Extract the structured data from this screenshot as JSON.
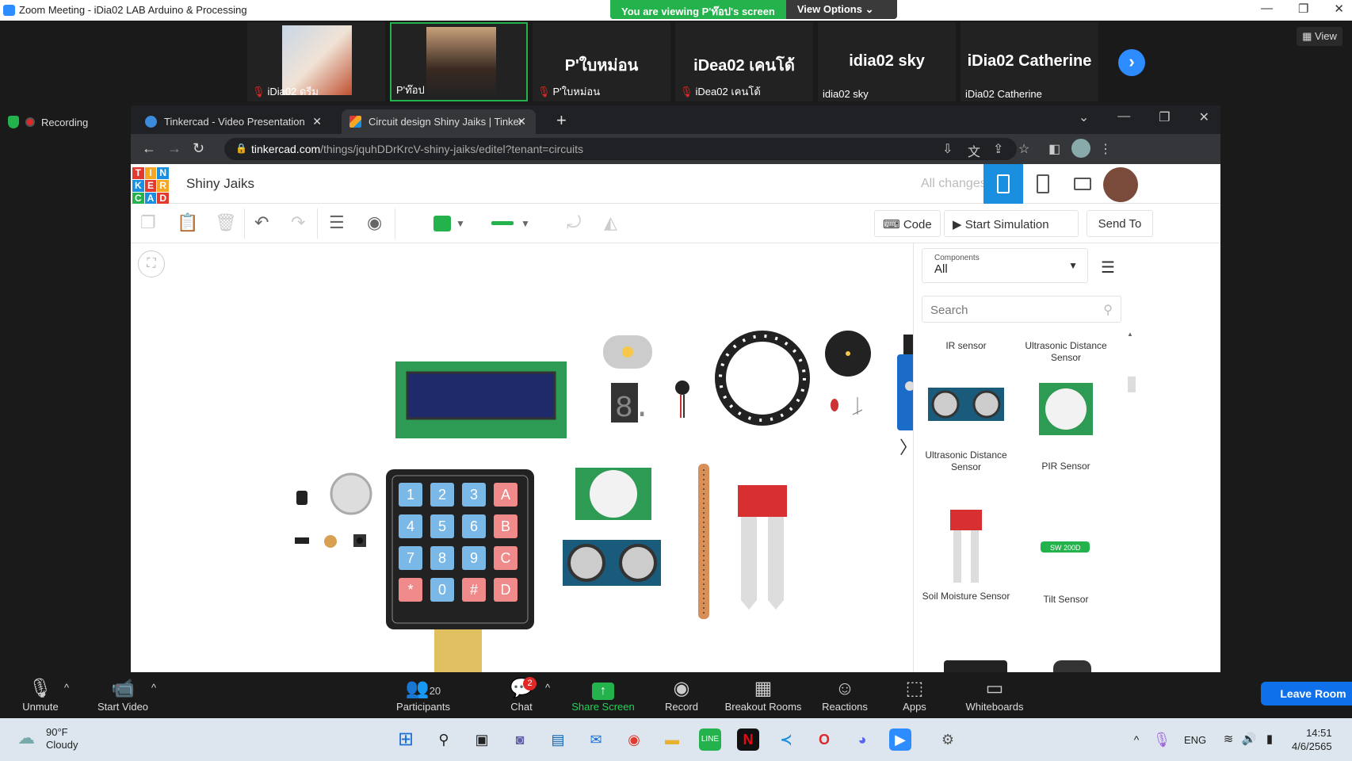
{
  "zoom": {
    "window_title": "Zoom Meeting - iDia02 LAB Arduino & Processing",
    "viewing_text": "You are viewing P'ท๊อป's screen",
    "view_options_label": "View Options",
    "view_label": "View",
    "recording_label": "Recording",
    "participants": [
      {
        "name": "iDia02 ดรีม",
        "big": "",
        "muted": true,
        "photo": true
      },
      {
        "name": "P'ท๊อป",
        "big": "",
        "muted": false,
        "photo": true
      },
      {
        "name": "P'ใบหม่อน",
        "big": "P'ใบหม่อน",
        "muted": true,
        "photo": false
      },
      {
        "name": "iDea02 เคนโด้",
        "big": "iDea02 เคนโด้",
        "muted": true,
        "photo": false
      },
      {
        "name": "idia02 sky",
        "big": "idia02 sky",
        "muted": false,
        "photo": false
      },
      {
        "name": "iDia02 Catherine",
        "big": "iDia02 Catherine",
        "muted": false,
        "photo": false
      }
    ],
    "toolbar": {
      "unmute": "Unmute",
      "start_video": "Start Video",
      "participants": "Participants",
      "participants_count": "20",
      "chat": "Chat",
      "chat_badge": "2",
      "share_screen": "Share Screen",
      "record": "Record",
      "breakout_rooms": "Breakout Rooms",
      "reactions": "Reactions",
      "apps": "Apps",
      "whiteboards": "Whiteboards",
      "leave_room": "Leave Room"
    }
  },
  "browser": {
    "tabs": [
      {
        "title": "Tinkercad - Video Presentation",
        "active": false
      },
      {
        "title": "Circuit design Shiny Jaiks | Tinker",
        "active": true
      }
    ],
    "url_domain": "tinkercad.com",
    "url_path": "/things/jquhDDrKrcV-shiny-jaiks/editel?tenant=circuits"
  },
  "tinkercad": {
    "logo_letters": [
      "T",
      "I",
      "N",
      "K",
      "E",
      "R",
      "C",
      "A",
      "D"
    ],
    "logo_colors": [
      "#e23a2e",
      "#f5a623",
      "#1a8fe0",
      "#1a8fe0",
      "#e23a2e",
      "#f5a623",
      "#23b24b",
      "#1a8fe0",
      "#e23a2e"
    ],
    "design_name": "Shiny Jaiks",
    "save_status": "All changes saved",
    "code_label": "Code",
    "start_simulation_label": "Start Simulation",
    "send_to_label": "Send To",
    "components_label": "Components",
    "components_value": "All",
    "search_placeholder": "Search",
    "components": [
      {
        "label": "IR sensor"
      },
      {
        "label": "Ultrasonic Distance Sensor"
      },
      {
        "label": "Ultrasonic Distance Sensor"
      },
      {
        "label": "PIR Sensor"
      },
      {
        "label": "Soil Moisture Sensor"
      },
      {
        "label": "Tilt Sensor"
      }
    ],
    "tilt_chip_text": "SW 200D",
    "keypad_keys": [
      "1",
      "2",
      "3",
      "A",
      "4",
      "5",
      "6",
      "B",
      "7",
      "8",
      "9",
      "C",
      "*",
      "0",
      "#",
      "D"
    ],
    "seven_seg_digit": "8."
  },
  "taskbar": {
    "weather_temp": "90°F",
    "weather_desc": "Cloudy",
    "language": "ENG",
    "time": "14:51",
    "date": "4/6/2565"
  },
  "colors": {
    "zoom_blue": "#2d8cff",
    "share_green": "#23b24b",
    "tinkercad_blue": "#1a8fe0",
    "leave_blue": "#0e71eb"
  }
}
